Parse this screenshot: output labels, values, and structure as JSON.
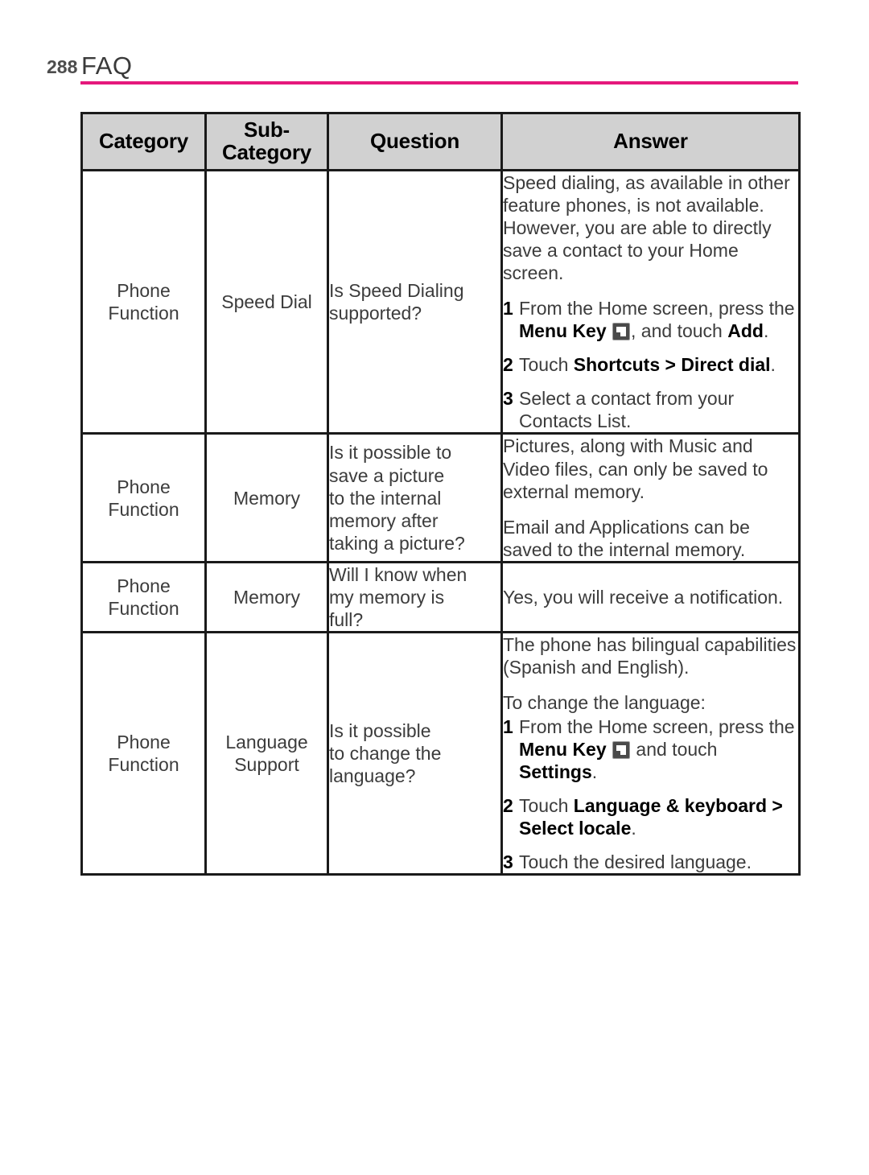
{
  "page": {
    "number": "288",
    "title": "FAQ",
    "rule_color": "#e5187c"
  },
  "table": {
    "headers": {
      "category": "Category",
      "subcategory_line1": "Sub-",
      "subcategory_line2": "Category",
      "question": "Question",
      "answer": "Answer"
    },
    "rows": [
      {
        "category_line1": "Phone",
        "category_line2": "Function",
        "subcategory": "Speed Dial",
        "question_line1": "Is Speed Dialing",
        "question_line2": "supported?",
        "answer_intro": "Speed dialing, as available in other feature phones, is not available. However, you are able to directly save a contact to your Home screen.",
        "steps": [
          {
            "num": "1",
            "pre": "From the Home screen, press the ",
            "bold1": "Menu Key",
            "icon": "menu-key-icon",
            "mid": ", and touch ",
            "bold2": "Add",
            "post": "."
          },
          {
            "num": "2",
            "pre": "Touch ",
            "bold1": "Shortcuts > Direct dial",
            "post": "."
          },
          {
            "num": "3",
            "pre": "Select a contact from your Contacts List."
          }
        ]
      },
      {
        "category_line1": "Phone",
        "category_line2": "Function",
        "subcategory": "Memory",
        "question_line1": "Is it possible to",
        "question_line2": "save a picture",
        "question_line3": "to the internal",
        "question_line4": "memory after",
        "question_line5": "taking a picture?",
        "answer_p1": "Pictures, along with Music and Video files, can only be saved to external memory.",
        "answer_p2": "Email and Applications can be saved to the internal memory."
      },
      {
        "category_line1": "Phone",
        "category_line2": "Function",
        "subcategory": "Memory",
        "question_line1": "Will I know when",
        "question_line2": "my memory is",
        "question_line3": "full?",
        "answer_p1": "Yes, you will receive a notification."
      },
      {
        "category_line1": "Phone",
        "category_line2": "Function",
        "subcategory_line1": "Language",
        "subcategory_line2": "Support",
        "question_line1": "Is it possible",
        "question_line2": "to change the",
        "question_line3": "language?",
        "answer_p1": "The phone has bilingual capabilities (Spanish and English).",
        "answer_p2": "To change the language:",
        "steps": [
          {
            "num": "1",
            "pre": "From the Home screen, press the ",
            "bold1": "Menu Key",
            "icon": "menu-key-icon",
            "mid": " and touch ",
            "bold2": "Settings",
            "post": "."
          },
          {
            "num": "2",
            "pre": "Touch ",
            "bold1": "Language & keyboard > Select locale",
            "post": "."
          },
          {
            "num": "3",
            "pre": "Touch the desired language."
          }
        ]
      }
    ]
  }
}
